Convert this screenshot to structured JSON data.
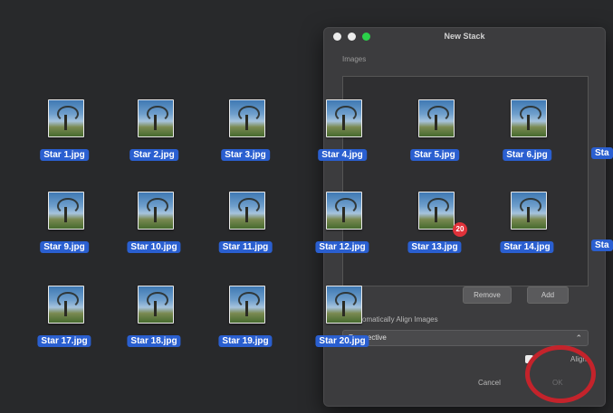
{
  "desktop": {
    "files": [
      {
        "name": "Star 1.jpg"
      },
      {
        "name": "Star 2.jpg"
      },
      {
        "name": "Star 3.jpg"
      },
      {
        "name": "Star 9.jpg"
      },
      {
        "name": "Star 10.jpg"
      },
      {
        "name": "Star 11.jpg"
      },
      {
        "name": "Star 17.jpg"
      },
      {
        "name": "Star 18.jpg"
      },
      {
        "name": "Star 19.jpg"
      }
    ]
  },
  "dialog": {
    "title": "New Stack",
    "images_label": "Images",
    "images": [
      {
        "name": "Star 4.jpg"
      },
      {
        "name": "Star 5.jpg"
      },
      {
        "name": "Star 6.jpg"
      },
      {
        "name": "Sta"
      },
      {
        "name": "Star 12.jpg"
      },
      {
        "name": "Star 13.jpg"
      },
      {
        "name": "Star 14.jpg"
      },
      {
        "name": "Sta"
      },
      {
        "name": "Star 20.jpg"
      }
    ],
    "drag_count": "20",
    "remove_label": "Remove",
    "add_label": "Add",
    "align_label": "Automatically Align Images",
    "align_visible_text": "omatically Align Images",
    "projection_value": "Perspective",
    "right_option_label": "Align",
    "cancel_label": "Cancel",
    "ok_label": "OK"
  },
  "colors": {
    "selection": "#2a5fd0",
    "dialog_bg": "#3c3c3e",
    "highlight_ring": "#c4232b",
    "badge": "#e0323a"
  }
}
